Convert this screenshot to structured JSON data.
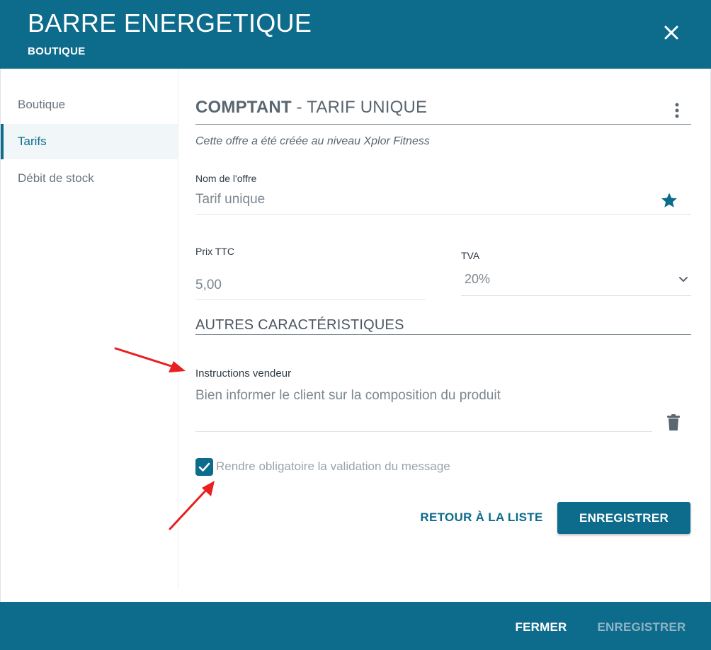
{
  "header": {
    "title": "BARRE ENERGETIQUE",
    "subtitle": "BOUTIQUE"
  },
  "sidebar": {
    "items": [
      {
        "label": "Boutique",
        "active": false
      },
      {
        "label": "Tarifs",
        "active": true
      },
      {
        "label": "Débit de stock",
        "active": false
      }
    ]
  },
  "main": {
    "section_title_bold": "COMPTANT",
    "section_title_rest": " - TARIF UNIQUE",
    "origin_note": "Cette offre a été créée au niveau Xplor Fitness",
    "offer_name": {
      "label": "Nom de l'offre",
      "value": "Tarif unique"
    },
    "price": {
      "label": "Prix TTC",
      "value": "5,00"
    },
    "vat": {
      "label": "TVA",
      "value": "20%"
    },
    "other_section_title": "AUTRES CARACTÉRISTIQUES",
    "seller_instructions": {
      "label": "Instructions vendeur",
      "value": "Bien informer le client sur la composition du produit"
    },
    "mandatory_validation": {
      "label": "Rendre obligatoire la validation du message",
      "checked": true
    },
    "back_label": "RETOUR À LA LISTE",
    "save_label": "ENREGISTRER"
  },
  "footer": {
    "close_label": "FERMER",
    "save_label": "ENREGISTRER"
  },
  "colors": {
    "brand": "#0d6b8c",
    "annotation_arrow": "#e8201f"
  }
}
